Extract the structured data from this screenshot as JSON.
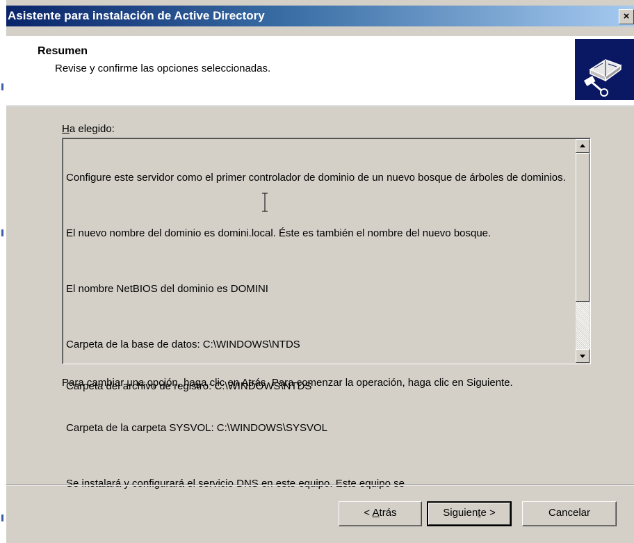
{
  "window": {
    "title": "Asistente para instalación de Active Directory",
    "close_glyph": "×"
  },
  "header": {
    "title": "Resumen",
    "subtitle": "Revise y confirme las opciones seleccionadas.",
    "icon": "directory-book-icon"
  },
  "summary": {
    "label_mnemonic": "H",
    "label_rest": "a elegido:",
    "paragraphs": [
      "Configure este servidor como el primer controlador de dominio de un nuevo bosque de árboles de dominios.",
      "El nuevo nombre del dominio es domini.local. Éste es también el nombre del nuevo bosque.",
      "El nombre NetBIOS del dominio es DOMINI"
    ],
    "folders": [
      "Carpeta de la base de datos: C:\\WINDOWS\\NTDS",
      "Carpeta del archivo de registro: C:\\WINDOWS\\NTDS",
      "Carpeta de la carpeta SYSVOL: C:\\WINDOWS\\SYSVOL"
    ],
    "dns_line": "Se instalará y configurará el servicio DNS en este equipo. Este equipo se"
  },
  "instructions": "Para cambiar una opción, haga clic en Atrás. Para comenzar la operación, haga clic en Siguiente.",
  "buttons": {
    "back_prefix": "< ",
    "back_mnemonic": "A",
    "back_rest": "trás",
    "next_prefix": "Siguien",
    "next_mnemonic": "t",
    "next_rest": "e >",
    "cancel": "Cancelar"
  },
  "colors": {
    "title_start": "#0a246a",
    "title_end": "#a6caf0",
    "face": "#d4d0c8",
    "icon_bg": "#0a1863"
  }
}
